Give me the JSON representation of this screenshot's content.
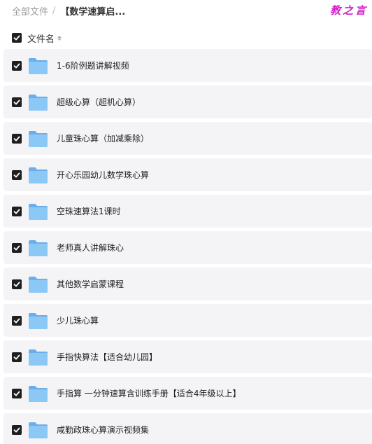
{
  "breadcrumb": {
    "root": "全部文件",
    "separator": "/",
    "current": "【数学速算启..."
  },
  "watermark": "教之言",
  "header": {
    "select_all_checked": true,
    "column_label": "文件名",
    "sort_icon": "sort-icon"
  },
  "files": [
    {
      "name": "1-6阶例题讲解视频",
      "checked": true,
      "icon": "folder-icon"
    },
    {
      "name": "超级心算（超机心算）",
      "checked": true,
      "icon": "folder-icon"
    },
    {
      "name": "儿童珠心算（加减乘除）",
      "checked": true,
      "icon": "folder-icon"
    },
    {
      "name": "开心乐园幼儿数学珠心算",
      "checked": true,
      "icon": "folder-icon"
    },
    {
      "name": "空珠速算法1课时",
      "checked": true,
      "icon": "folder-icon"
    },
    {
      "name": "老师真人讲解珠心",
      "checked": true,
      "icon": "folder-icon"
    },
    {
      "name": "其他数学启蒙课程",
      "checked": true,
      "icon": "folder-icon"
    },
    {
      "name": "少儿珠心算",
      "checked": true,
      "icon": "folder-icon"
    },
    {
      "name": "手指快算法【适合幼儿园】",
      "checked": true,
      "icon": "folder-icon"
    },
    {
      "name": "手指算 一分钟速算含训练手册【适合4年级以上】",
      "checked": true,
      "icon": "folder-icon"
    },
    {
      "name": "咸勤政珠心算演示视频集",
      "checked": true,
      "icon": "folder-icon"
    }
  ],
  "colors": {
    "checkbox": "#1f1f1f",
    "row_bg": "#f4f4f6",
    "folder": "#7cbcf2",
    "watermark": "#d020c8"
  }
}
